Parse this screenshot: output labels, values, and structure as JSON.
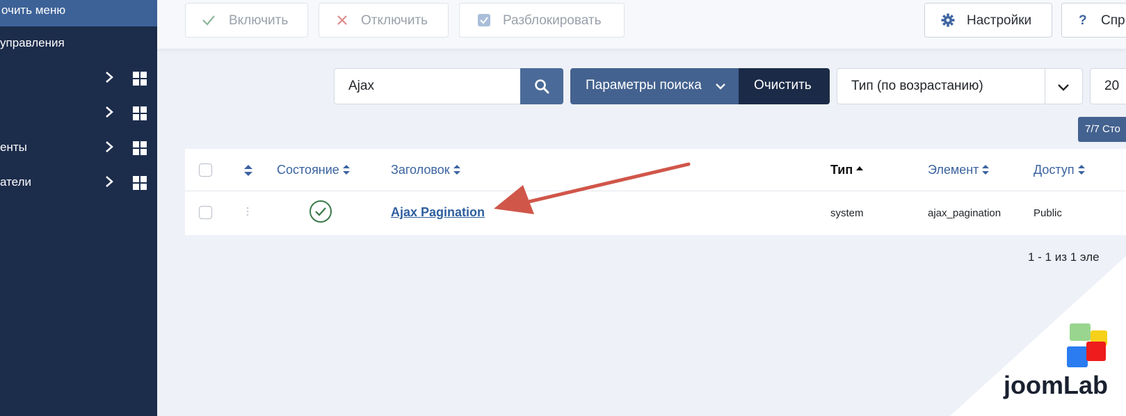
{
  "sidebar": {
    "top_label": "очить меню",
    "items": [
      {
        "label": "управления"
      },
      {
        "label": ""
      },
      {
        "label": ""
      },
      {
        "label": "енты"
      },
      {
        "label": "атели"
      }
    ]
  },
  "toolbar": {
    "enable_label": "Включить",
    "disable_label": "Отключить",
    "unlock_label": "Разблокировать",
    "settings_label": "Настройки",
    "help_label": "Спр"
  },
  "search": {
    "value": "Ajax",
    "params_label": "Параметры поиска",
    "clear_label": "Очистить",
    "sort_value": "Тип (по возрастанию)",
    "limit_value": "20",
    "columns_badge": "7/7 Сто"
  },
  "table": {
    "headers": {
      "status": "Состояние",
      "title": "Заголовок",
      "type": "Тип",
      "element": "Элемент",
      "access": "Доступ"
    },
    "rows": [
      {
        "title": "Ajax Pagination",
        "type": "system",
        "element": "ajax_pagination",
        "access": "Public",
        "status": "enabled"
      }
    ]
  },
  "pagination": {
    "text": "1 - 1 из 1 эле"
  },
  "logo": {
    "text": "joomLab"
  },
  "colors": {
    "sidebar": "#1c2c4b",
    "accent": "#44628f",
    "dark_button": "#1b2b47",
    "link": "#2f5f9e",
    "arrow": "#d0564a",
    "success": "#3a7a4a"
  }
}
